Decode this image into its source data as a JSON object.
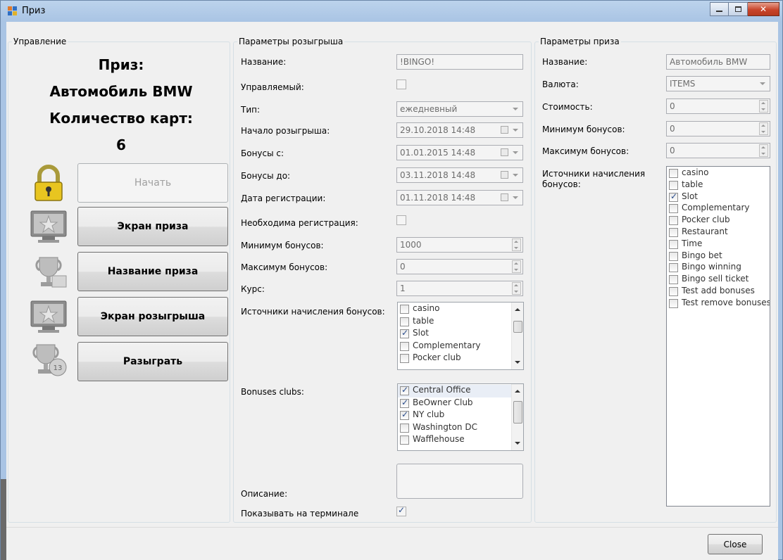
{
  "window": {
    "title": "Приз",
    "colors": {
      "titlebar": "#a9c4e4",
      "close": "#c8452b",
      "client": "#f0f0f0"
    }
  },
  "control": {
    "group_label": "Управление",
    "prize_label": "Приз:",
    "prize_name": "Автомобиль BMW",
    "cards_label": "Количество карт:",
    "cards_count": "6",
    "buttons": [
      {
        "label": "Начать",
        "icon": "padlock-icon",
        "enabled": false
      },
      {
        "label": "Экран приза",
        "icon": "monitor-star-icon",
        "enabled": true
      },
      {
        "label": "Название приза",
        "icon": "trophy-icon",
        "enabled": true
      },
      {
        "label": "Экран розыгрыша",
        "icon": "monitor-star-icon",
        "enabled": true
      },
      {
        "label": "Разыграть",
        "icon": "trophy-ball-icon",
        "enabled": true
      }
    ]
  },
  "draw": {
    "group_label": "Параметры розыгрыша",
    "name": {
      "label": "Название:",
      "value": "!BINGO!"
    },
    "managed": {
      "label": "Управляемый:",
      "checked": false
    },
    "type": {
      "label": "Тип:",
      "value": "ежедневный"
    },
    "start": {
      "label": "Начало розыгрыша:",
      "value": "29.10.2018 14:48"
    },
    "bonus_from": {
      "label": "Бонусы с:",
      "value": "01.01.2015 14:48"
    },
    "bonus_to": {
      "label": "Бонусы до:",
      "value": "03.11.2018 14:48"
    },
    "reg_date": {
      "label": "Дата регистрации:",
      "value": "01.11.2018 14:48"
    },
    "reg_required": {
      "label": "Необходима регистрация:",
      "checked": false
    },
    "min_bonus": {
      "label": "Минимум бонусов:",
      "value": "1000"
    },
    "max_bonus": {
      "label": "Максимум бонусов:",
      "value": "0"
    },
    "rate": {
      "label": "Курс:",
      "value": "1"
    },
    "sources": {
      "label": "Источники начисления бонусов:",
      "items": [
        {
          "text": "casino",
          "checked": false
        },
        {
          "text": "table",
          "checked": false
        },
        {
          "text": "Slot",
          "checked": true
        },
        {
          "text": "Complementary",
          "checked": false
        },
        {
          "text": "Pocker club",
          "checked": false
        }
      ]
    },
    "clubs": {
      "label": "Bonuses clubs:",
      "items": [
        {
          "text": "Central Office",
          "checked": true
        },
        {
          "text": "BeOwner Club",
          "checked": true
        },
        {
          "text": "NY club",
          "checked": true
        },
        {
          "text": "Washington DC",
          "checked": false
        },
        {
          "text": "Wafflehouse",
          "checked": false
        }
      ]
    },
    "description": {
      "label": "Описание:",
      "value": ""
    },
    "show_terminal": {
      "label": "Показывать на терминале",
      "checked": true
    }
  },
  "prize": {
    "group_label": "Параметры приза",
    "name": {
      "label": "Название:",
      "value": "Автомобиль BMW"
    },
    "currency": {
      "label": "Валюта:",
      "value": "ITEMS"
    },
    "cost": {
      "label": "Стоимость:",
      "value": "0"
    },
    "min_bonus": {
      "label": "Минимум бонусов:",
      "value": "0"
    },
    "max_bonus": {
      "label": "Максимум бонусов:",
      "value": "0"
    },
    "sources": {
      "label": "Источники начисления бонусов:",
      "items": [
        {
          "text": "casino",
          "checked": false
        },
        {
          "text": "table",
          "checked": false
        },
        {
          "text": "Slot",
          "checked": true
        },
        {
          "text": "Complementary",
          "checked": false
        },
        {
          "text": "Pocker club",
          "checked": false
        },
        {
          "text": "Restaurant",
          "checked": false
        },
        {
          "text": "Time",
          "checked": false
        },
        {
          "text": "Bingo bet",
          "checked": false
        },
        {
          "text": "Bingo winning",
          "checked": false
        },
        {
          "text": "Bingo sell ticket",
          "checked": false
        },
        {
          "text": "Test add bonuses",
          "checked": false
        },
        {
          "text": "Test remove bonuses",
          "checked": false
        }
      ]
    }
  },
  "footer": {
    "close_label": "Close"
  }
}
